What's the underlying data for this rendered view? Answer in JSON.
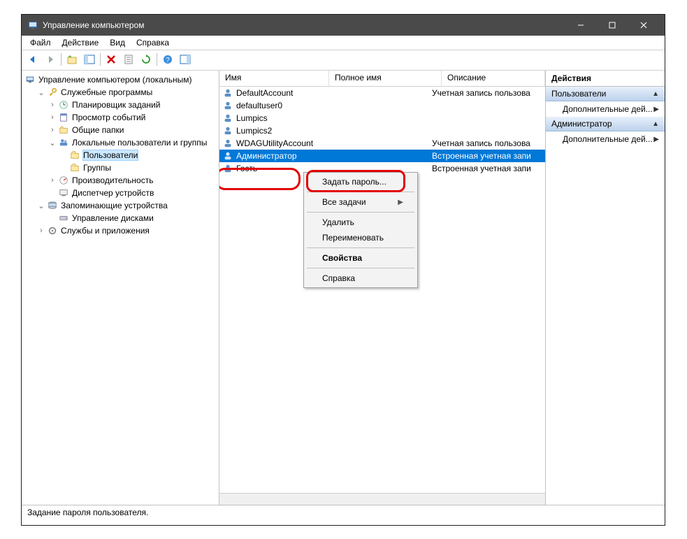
{
  "window": {
    "title": "Управление компьютером"
  },
  "menu": {
    "file": "Файл",
    "action": "Действие",
    "view": "Вид",
    "help": "Справка"
  },
  "tree": {
    "root": "Управление компьютером (локальным)",
    "system_tools": "Служебные программы",
    "task_scheduler": "Планировщик заданий",
    "event_viewer": "Просмотр событий",
    "shared_folders": "Общие папки",
    "local_users_groups": "Локальные пользователи и группы",
    "users": "Пользователи",
    "groups": "Группы",
    "performance": "Производительность",
    "device_manager": "Диспетчер устройств",
    "storage": "Запоминающие устройства",
    "disk_management": "Управление дисками",
    "services_apps": "Службы и приложения"
  },
  "list": {
    "columns": {
      "name": "Имя",
      "fullname": "Полное имя",
      "description": "Описание"
    },
    "rows": [
      {
        "name": "DefaultAccount",
        "fullname": "",
        "description": "Учетная запись пользова"
      },
      {
        "name": "defaultuser0",
        "fullname": "",
        "description": ""
      },
      {
        "name": "Lumpics",
        "fullname": "",
        "description": ""
      },
      {
        "name": "Lumpics2",
        "fullname": "",
        "description": ""
      },
      {
        "name": "WDAGUtilityAccount",
        "fullname": "",
        "description": "Учетная запись пользова"
      },
      {
        "name": "Администратор",
        "fullname": "",
        "description": "Встроенная учетная запи"
      },
      {
        "name": "Гость",
        "fullname": "",
        "description": "Встроенная учетная запи"
      }
    ]
  },
  "context_menu": {
    "set_password": "Задать пароль...",
    "all_tasks": "Все задачи",
    "delete": "Удалить",
    "rename": "Переименовать",
    "properties": "Свойства",
    "help": "Справка"
  },
  "actions": {
    "title": "Действия",
    "group1": "Пользователи",
    "item_more1": "Дополнительные дей...",
    "group2": "Администратор",
    "item_more2": "Дополнительные дей..."
  },
  "status": "Задание пароля пользователя."
}
